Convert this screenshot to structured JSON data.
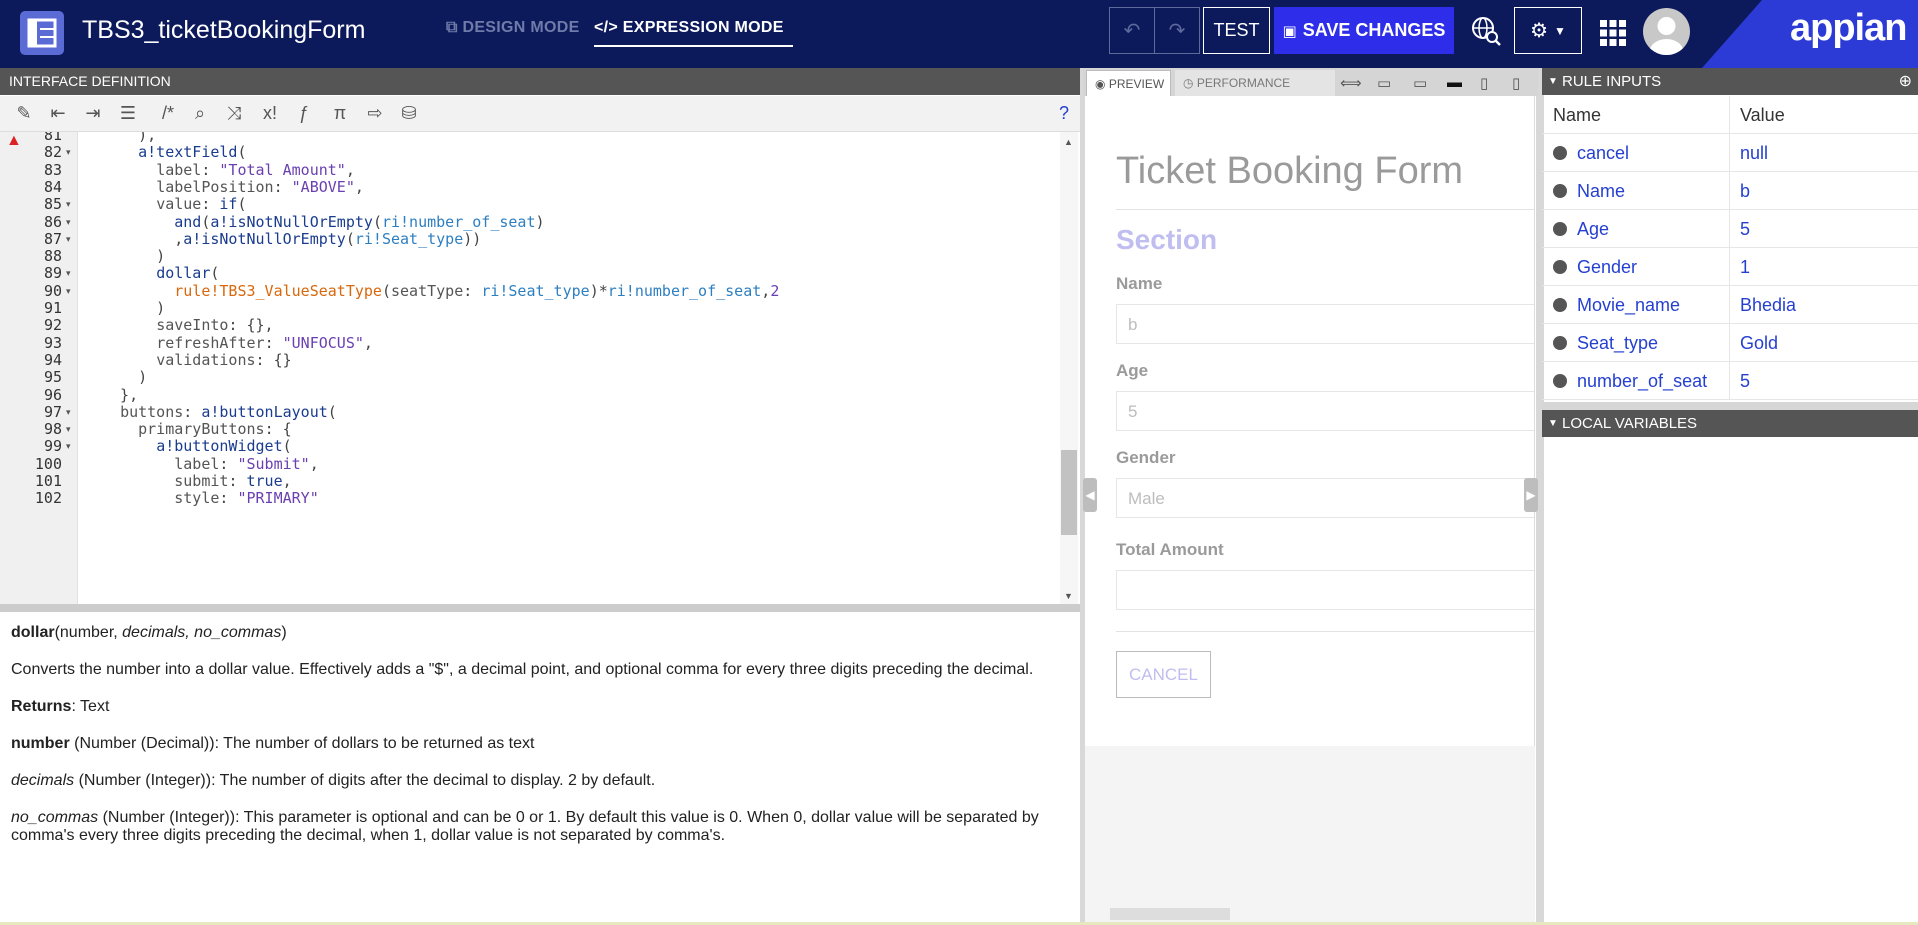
{
  "header": {
    "title": "TBS3_ticketBookingForm",
    "design_mode": "DESIGN MODE",
    "expression_mode": "EXPRESSION MODE",
    "test_label": "TEST",
    "save_label": "SAVE CHANGES",
    "brand": "appian"
  },
  "interface_definition": {
    "heading": "INTERFACE DEFINITION",
    "lines": [
      {
        "no": "81",
        "html": "    ),"
      },
      {
        "no": "82",
        "html": "    <span class='k-fn'>a!textField</span>("
      },
      {
        "no": "83",
        "html": "      <span class='k-prop'>label</span>: <span class='k-str'>\"Total Amount\"</span>,"
      },
      {
        "no": "84",
        "html": "      <span class='k-prop'>labelPosition</span>: <span class='k-str'>\"ABOVE\"</span>,"
      },
      {
        "no": "85",
        "html": "      <span class='k-prop'>value</span>: <span class='k-fn'>if</span>("
      },
      {
        "no": "86",
        "html": "        <span class='k-fn'>and</span>(<span class='k-fn'>a!isNotNullOrEmpty</span>(<span class='k-ri'>ri!number_of_seat</span>)"
      },
      {
        "no": "87",
        "html": "        ,<span class='k-fn'>a!isNotNullOrEmpty</span>(<span class='k-ri'>ri!Seat_type</span>))"
      },
      {
        "no": "88",
        "html": "      )"
      },
      {
        "no": "89",
        "html": "      <span class='k-fn'>dollar</span>("
      },
      {
        "no": "90",
        "html": "        <span class='k-rule'>rule!TBS3_ValueSeatType</span>(<span class='k-prop'>seatType</span>: <span class='k-ri'>ri!Seat_type</span>)*<span class='k-ri'>ri!number_of_seat</span>,<span class='k-str'>2</span>"
      },
      {
        "no": "91",
        "html": "      )"
      },
      {
        "no": "92",
        "html": "      <span class='k-prop'>saveInto</span>: {},"
      },
      {
        "no": "93",
        "html": "      <span class='k-prop'>refreshAfter</span>: <span class='k-str'>\"UNFOCUS\"</span>,"
      },
      {
        "no": "94",
        "html": "      <span class='k-prop'>validations</span>: {}"
      },
      {
        "no": "95",
        "html": "    )"
      },
      {
        "no": "96",
        "html": "  },"
      },
      {
        "no": "97",
        "html": "  <span class='k-prop'>buttons</span>: <span class='k-fn'>a!buttonLayout</span>("
      },
      {
        "no": "98",
        "html": "    <span class='k-prop'>primaryButtons</span>: {"
      },
      {
        "no": "99",
        "html": "      <span class='k-fn'>a!buttonWidget</span>("
      },
      {
        "no": "100",
        "html": "        <span class='k-prop'>label</span>: <span class='k-str'>\"Submit\"</span>,"
      },
      {
        "no": "101",
        "html": "        <span class='k-prop'>submit</span>: <span class='k-kw'>true</span>,"
      },
      {
        "no": "102",
        "html": "        <span class='k-prop'>style</span>: <span class='k-str'>\"PRIMARY\"</span>"
      }
    ],
    "folds": [
      "82",
      "85",
      "86",
      "87",
      "89",
      "90",
      "97",
      "98",
      "99"
    ]
  },
  "doc": {
    "signature_name": "dollar",
    "signature_args_plain": "(number, ",
    "signature_args_italic": "decimals, no_commas",
    "signature_close": ")",
    "description": "Converts the number into a dollar value. Effectively adds a \"$\", a decimal point, and optional comma for every three digits preceding the decimal.",
    "returns_label": "Returns",
    "returns_value": ": Text",
    "params": [
      {
        "name": "number",
        "italic": false,
        "text": " (Number (Decimal)): The number of dollars to be returned as text"
      },
      {
        "name": "decimals",
        "italic": true,
        "text": " (Number (Integer)): The number of digits after the decimal to display. 2 by default."
      },
      {
        "name": "no_commas",
        "italic": true,
        "text": " (Number (Integer)): This parameter is optional and can be 0 or 1. By default this value is 0. When 0, dollar value will be separated by comma's every three digits preceding the decimal, when 1, dollar value is not separated by comma's."
      }
    ]
  },
  "preview": {
    "tab_preview": "PREVIEW",
    "tab_performance": "PERFORMANCE",
    "form_title": "Ticket Booking Form",
    "section": "Section",
    "fields": [
      {
        "label": "Name",
        "value": "b"
      },
      {
        "label": "Age",
        "value": "5"
      },
      {
        "label": "Gender",
        "value": "Male"
      },
      {
        "label": "Total Amount",
        "value": ""
      }
    ],
    "cancel": "CANCEL"
  },
  "rule_inputs": {
    "heading": "RULE INPUTS",
    "col_name": "Name",
    "col_value": "Value",
    "rows": [
      {
        "name": "cancel",
        "value": "null"
      },
      {
        "name": "Name",
        "value": "b"
      },
      {
        "name": "Age",
        "value": "5"
      },
      {
        "name": "Gender",
        "value": "1"
      },
      {
        "name": "Movie_name",
        "value": "Bhedia"
      },
      {
        "name": "Seat_type",
        "value": "Gold"
      },
      {
        "name": "number_of_seat",
        "value": "5"
      }
    ]
  },
  "local_variables": {
    "heading": "LOCAL VARIABLES"
  }
}
